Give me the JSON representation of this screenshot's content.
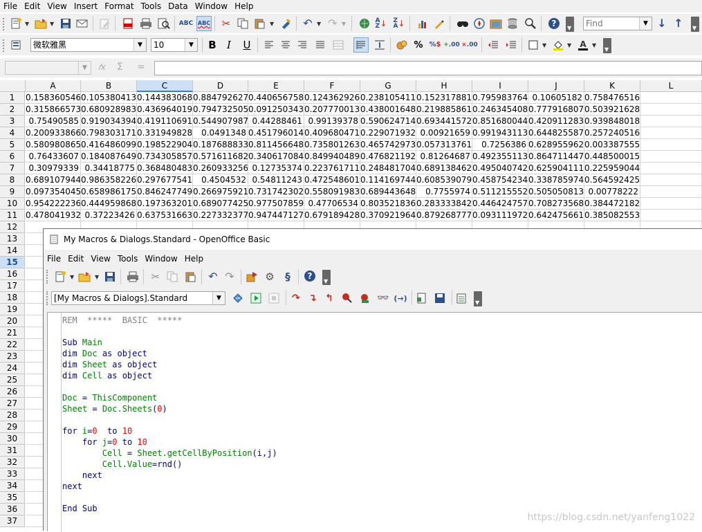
{
  "menu": [
    "File",
    "Edit",
    "View",
    "Insert",
    "Format",
    "Tools",
    "Data",
    "Window",
    "Help"
  ],
  "search": {
    "placeholder": "Find"
  },
  "font_name": "微软雅黑",
  "font_size": "10",
  "name_box": "",
  "formula_sym": {
    "func": "𝑓x",
    "sum": "Σ",
    "eq": "="
  },
  "columns": [
    "A",
    "B",
    "C",
    "D",
    "E",
    "F",
    "G",
    "H",
    "I",
    "J",
    "K",
    "L"
  ],
  "rows": [
    "1",
    "2",
    "3",
    "4",
    "5",
    "6",
    "7",
    "8",
    "9",
    "10",
    "11",
    "12",
    "13",
    "14",
    "15",
    "16",
    "17",
    "18",
    "19",
    "20",
    "21",
    "22",
    "23",
    "24",
    "25",
    "26",
    "27",
    "28",
    "29",
    "30",
    "31",
    "32",
    "33",
    "34",
    "35",
    "36",
    "37"
  ],
  "cells": [
    [
      "0.158360546",
      "0.105380413",
      "0.144383068",
      "0.884792627",
      "0.440656758",
      "0.124362926",
      "0.238105411",
      "0.152317881",
      "0.795983764",
      "0.10605182",
      "0.758476516"
    ],
    [
      "0.315866573",
      "0.680928983",
      "0.436964019",
      "0.794732505",
      "0.091250343",
      "0.207770013",
      "0.438001648",
      "0.219885861",
      "0.246345408",
      "0.777916807",
      "0.503921628"
    ],
    [
      "0.75490585",
      "0.919034394",
      "0.419110691",
      "0.544907987",
      "0.44288461",
      "0.99139378",
      "0.590624714",
      "0.693441572",
      "0.851680044",
      "0.420911283",
      "0.939848018"
    ],
    [
      "0.200933866",
      "0.798303171",
      "0.331949828",
      "0.0491348",
      "0.451796014",
      "0.409680471",
      "0.229071932",
      "0.00921659",
      "0.991943113",
      "0.644825587",
      "0.257240516"
    ],
    [
      "0.580980865",
      "0.416486099",
      "0.198522904",
      "0.187688833",
      "0.811456648",
      "0.735801263",
      "0.465742973",
      "0.057313761",
      "0.7256386",
      "0.628955962",
      "0.003387555"
    ],
    [
      "0.76433607",
      "0.184087649",
      "0.734305857",
      "0.571611682",
      "0.340617084",
      "0.849940489",
      "0.476821192",
      "0.81264687",
      "0.492355113",
      "0.864711447",
      "0.448500015"
    ],
    [
      "0.30979339",
      "0.34418775",
      "0.368480483",
      "0.260933256",
      "0.12735374",
      "0.223761711",
      "0.248481704",
      "0.689138462",
      "0.495040742",
      "0.625904111",
      "0.225959044"
    ],
    [
      "0.689107944",
      "0.986358226",
      "0.297677541",
      "0.4504532",
      "0.54811243",
      "0.472548601",
      "0.114169744",
      "0.608539079",
      "0.458754234",
      "0.338785974",
      "0.564592425"
    ],
    [
      "0.097354045",
      "0.658986175",
      "0.846247749",
      "0.266975921",
      "0.731742302",
      "0.558091983",
      "0.689443648",
      "0.7755974",
      "0.511215552",
      "0.505050813",
      "0.00778222"
    ],
    [
      "0.954222236",
      "0.444959868",
      "0.197363201",
      "0.689077425",
      "0.977507859",
      "0.47706534",
      "0.803521836",
      "0.283333842",
      "0.446424757",
      "0.708273568",
      "0.384472182"
    ],
    [
      "0.478041932",
      "0.37223426",
      "0.637531663",
      "0.227332377",
      "0.947447127",
      "0.679189428",
      "0.370921964",
      "0.879268777",
      "0.093111972",
      "0.642475661",
      "0.385082553"
    ]
  ],
  "basic": {
    "title": "My Macros & Dialogs.Standard - OpenOffice Basic",
    "menu": [
      "File",
      "Edit",
      "View",
      "Tools",
      "Window",
      "Help"
    ],
    "library": "[My Macros & Dialogs].Standard",
    "code": [
      [
        {
          "t": "REM  *****  BASIC  *****",
          "c": "gray"
        }
      ],
      [
        {
          "t": "",
          "c": ""
        }
      ],
      [
        {
          "t": "Sub ",
          "c": "blue"
        },
        {
          "t": "Main",
          "c": "green"
        }
      ],
      [
        {
          "t": "dim ",
          "c": "blue"
        },
        {
          "t": "Doc ",
          "c": "green"
        },
        {
          "t": "as object",
          "c": "blue"
        }
      ],
      [
        {
          "t": "dim ",
          "c": "blue"
        },
        {
          "t": "Sheet ",
          "c": "green"
        },
        {
          "t": "as object",
          "c": "blue"
        }
      ],
      [
        {
          "t": "dim ",
          "c": "blue"
        },
        {
          "t": "Cell ",
          "c": "green"
        },
        {
          "t": "as object",
          "c": "blue"
        }
      ],
      [
        {
          "t": "",
          "c": ""
        }
      ],
      [
        {
          "t": "Doc ",
          "c": "green"
        },
        {
          "t": "= ",
          "c": "blue"
        },
        {
          "t": "ThisComponent",
          "c": "green"
        }
      ],
      [
        {
          "t": "Sheet ",
          "c": "green"
        },
        {
          "t": "= ",
          "c": "blue"
        },
        {
          "t": "Doc.Sheets",
          "c": "green"
        },
        {
          "t": "(",
          "c": "blue"
        },
        {
          "t": "0",
          "c": "red"
        },
        {
          "t": ")",
          "c": "blue"
        }
      ],
      [
        {
          "t": "",
          "c": ""
        }
      ],
      [
        {
          "t": "for ",
          "c": "blue"
        },
        {
          "t": "i",
          "c": "green"
        },
        {
          "t": "=",
          "c": "blue"
        },
        {
          "t": "0",
          "c": "red"
        },
        {
          "t": "  to ",
          "c": "blue"
        },
        {
          "t": "10",
          "c": "red"
        }
      ],
      [
        {
          "t": "    for ",
          "c": "blue"
        },
        {
          "t": "j",
          "c": "green"
        },
        {
          "t": "=",
          "c": "blue"
        },
        {
          "t": "0",
          "c": "red"
        },
        {
          "t": " to ",
          "c": "blue"
        },
        {
          "t": "10",
          "c": "red"
        }
      ],
      [
        {
          "t": "        Cell ",
          "c": "green"
        },
        {
          "t": "= ",
          "c": "blue"
        },
        {
          "t": "Sheet.getCellByPosition",
          "c": "green"
        },
        {
          "t": "(i,j)",
          "c": "blue"
        }
      ],
      [
        {
          "t": "        Cell.Value",
          "c": "green"
        },
        {
          "t": "=rnd()",
          "c": "blue"
        }
      ],
      [
        {
          "t": "    next",
          "c": "blue"
        }
      ],
      [
        {
          "t": "next",
          "c": "blue"
        }
      ],
      [
        {
          "t": "",
          "c": ""
        }
      ],
      [
        {
          "t": "End Sub",
          "c": "blue"
        }
      ]
    ]
  },
  "watermark": "https://blog.csdn.net/yanfeng1022"
}
